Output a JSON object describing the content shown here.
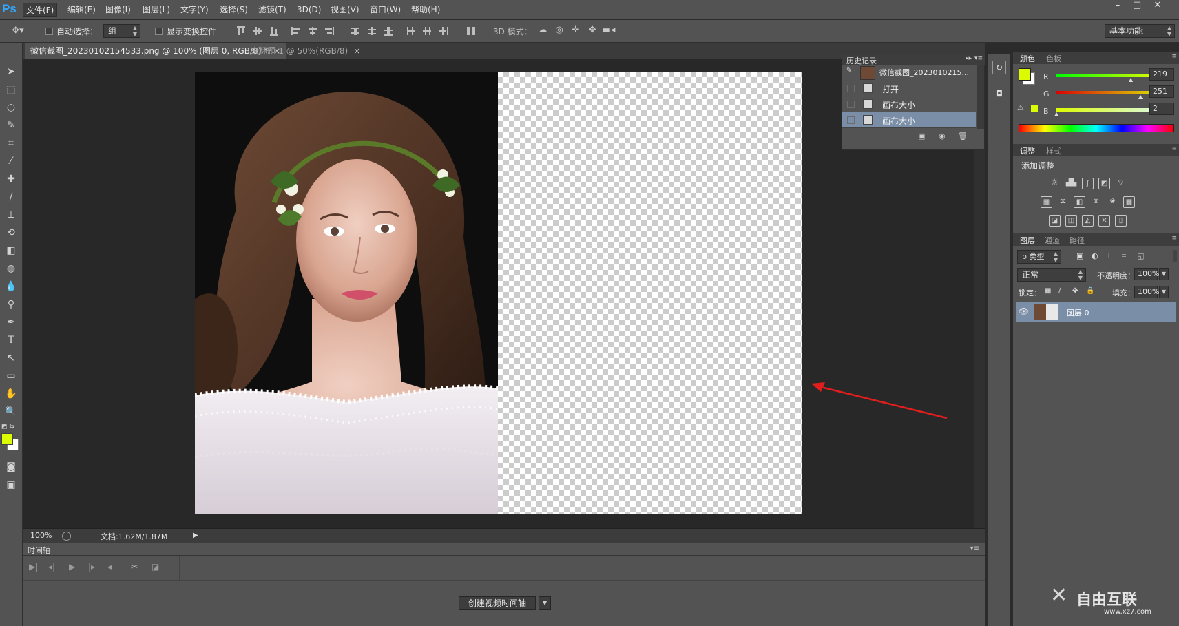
{
  "app": {
    "logo": "Ps"
  },
  "menu": [
    "文件(F)",
    "编辑(E)",
    "图像(I)",
    "图层(L)",
    "文字(Y)",
    "选择(S)",
    "滤镜(T)",
    "3D(D)",
    "视图(V)",
    "窗口(W)",
    "帮助(H)"
  ],
  "window_controls": {
    "minimize": "–",
    "maximize": "□",
    "close": "✕"
  },
  "options": {
    "auto_select_label": "自动选择：",
    "auto_select_value": "组",
    "show_transform_label": "显示变换控件",
    "mode_3d_label": "3D 模式：",
    "workspace": "基本功能"
  },
  "tabs": [
    {
      "label": "微信截图_20230102154533.png @ 100% (图层 0, RGB/8) *",
      "close": "×"
    },
    {
      "label": "未标题-1 @ 50%(RGB/8)",
      "close": "×"
    }
  ],
  "status": {
    "zoom": "100%",
    "doc": "文档:1.62M/1.87M"
  },
  "timeline": {
    "tab": "时间轴",
    "create_button": "创建视频时间轴"
  },
  "history": {
    "tab": "历史记录",
    "snapshot": "微信截图_2023010215...",
    "items": [
      "打开",
      "画布大小",
      "画布大小"
    ]
  },
  "color_panel": {
    "tabs": [
      "颜色",
      "色板"
    ],
    "r_label": "R",
    "r": "219",
    "g_label": "G",
    "g": "251",
    "b_label": "B",
    "b": "2",
    "foreground": "#dbfb02",
    "background": "#ffffff"
  },
  "adjust_panel": {
    "tabs": [
      "调整",
      "样式"
    ],
    "title": "添加调整"
  },
  "layers_panel": {
    "tabs": [
      "图层",
      "通道",
      "路径"
    ],
    "filter_label": "ρ 类型",
    "blend_mode": "正常",
    "opacity_label": "不透明度：",
    "opacity": "100%",
    "lock_label": "锁定：",
    "fill_label": "填充：",
    "fill": "100%",
    "layers": [
      {
        "name": "图层 0"
      }
    ]
  },
  "watermark": {
    "text": "自由互联",
    "sub": "www.xz7.com"
  },
  "colors": {
    "accent": "#7a8ea8",
    "arrow": "#e01e1e",
    "panel": "#535353"
  }
}
